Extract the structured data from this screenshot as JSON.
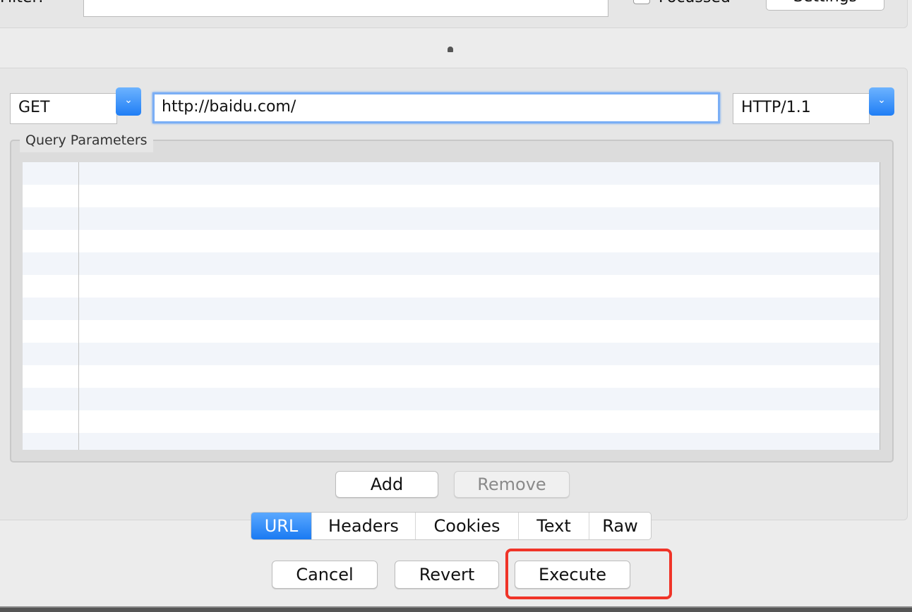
{
  "filter_bar": {
    "filter_label": "Filter:",
    "filter_value": "",
    "focussed_label": "Focussed",
    "focussed_checked": false,
    "settings_label": "Settings"
  },
  "request": {
    "method": "GET",
    "url": "http://baidu.com/",
    "protocol": "HTTP/1.1",
    "dropdown_icon": "chevron-down-icon"
  },
  "query_parameters": {
    "title": "Query Parameters",
    "rows": []
  },
  "param_buttons": {
    "add": "Add",
    "remove": "Remove"
  },
  "tabs": [
    {
      "label": "URL",
      "active": true
    },
    {
      "label": "Headers",
      "active": false
    },
    {
      "label": "Cookies",
      "active": false
    },
    {
      "label": "Text",
      "active": false
    },
    {
      "label": "Raw",
      "active": false
    }
  ],
  "actions": {
    "cancel": "Cancel",
    "revert": "Revert",
    "execute": "Execute"
  },
  "colors": {
    "accent": "#1f7ef5",
    "highlight": "#f03428"
  }
}
